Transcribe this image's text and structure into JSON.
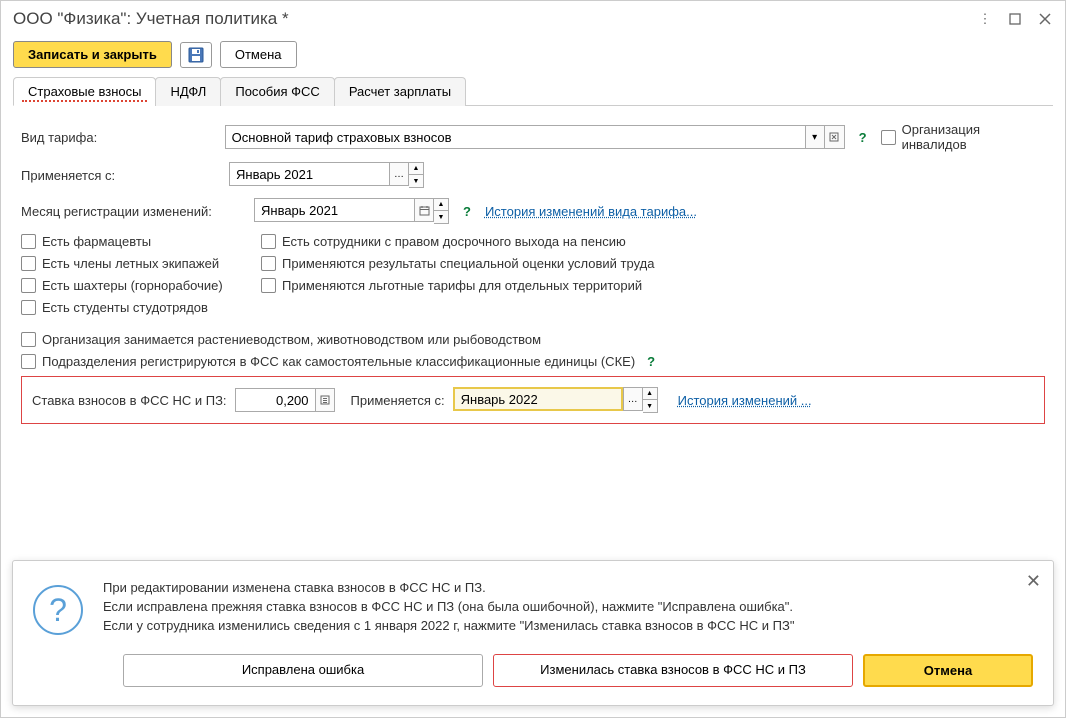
{
  "window": {
    "title": "ООО \"Физика\": Учетная политика *"
  },
  "toolbar": {
    "save_close": "Записать и закрыть",
    "cancel": "Отмена"
  },
  "tabs": {
    "insurance": "Страховые взносы",
    "ndfl": "НДФЛ",
    "fss": "Пособия ФСС",
    "payroll": "Расчет зарплаты"
  },
  "form": {
    "tariff_type_label": "Вид тарифа:",
    "tariff_type_value": "Основной тариф страховых взносов",
    "disabled_org": "Организация инвалидов",
    "applies_from_label": "Применяется с:",
    "applies_from_value": "Январь 2021",
    "reg_month_label": "Месяц регистрации изменений:",
    "reg_month_value": "Январь 2021",
    "history_link1": "История изменений вида тарифа...",
    "checks": {
      "pharmacists": "Есть фармацевты",
      "early_retire": "Есть сотрудники с правом досрочного выхода на пенсию",
      "flight_crew": "Есть члены летных экипажей",
      "special_eval": "Применяются результаты специальной оценки условий труда",
      "miners": "Есть шахтеры (горнорабочие)",
      "territory_rates": "Применяются льготные тарифы для отдельных территорий",
      "students": "Есть студенты студотрядов",
      "agriculture": "Организация занимается растениеводством, животноводством или рыбоводством",
      "subdivisions": "Подразделения регистрируются в ФСС как самостоятельные классификационные единицы (СКЕ)"
    },
    "fss_rate_label": "Ставка взносов в ФСС НС и ПЗ:",
    "fss_rate_value": "0,200",
    "fss_applies_label": "Применяется с:",
    "fss_applies_value": "Январь 2022",
    "history_link2": "История изменений ..."
  },
  "dialog": {
    "line1": "При редактировании изменена ставка взносов в ФСС НС и ПЗ.",
    "line2": "Если исправлена прежняя ставка взносов в ФСС НС и ПЗ (она была ошибочной), нажмите \"Исправлена ошибка\".",
    "line3": "Если у сотрудника изменились сведения с 1 января 2022 г, нажмите \"Изменилась ставка взносов в ФСС НС и ПЗ\"",
    "btn_fixed": "Исправлена ошибка",
    "btn_changed": "Изменилась ставка взносов в ФСС НС и ПЗ",
    "btn_cancel": "Отмена"
  }
}
